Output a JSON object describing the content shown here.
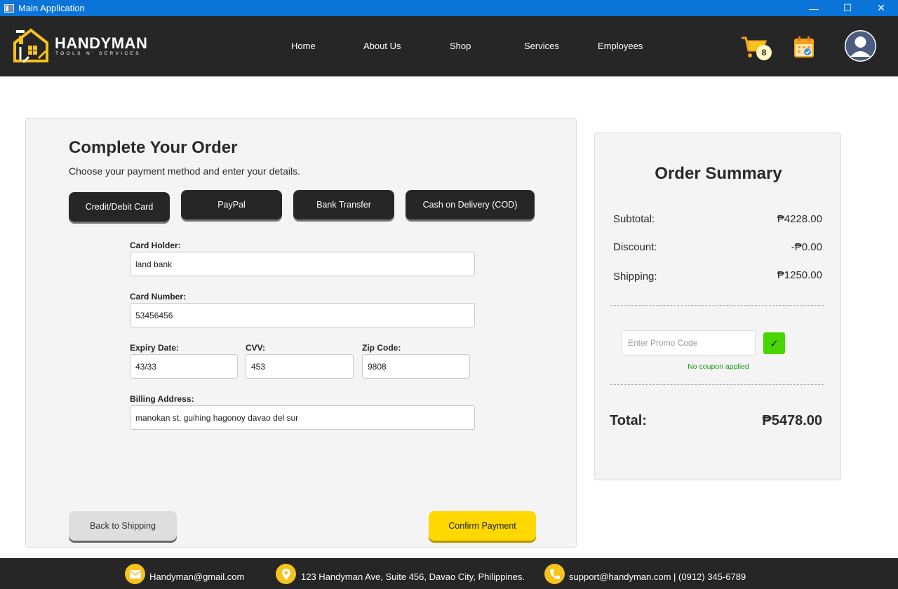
{
  "window": {
    "title": "Main Application",
    "controls": {
      "minimize": "—",
      "maximize": "☐",
      "close": "✕"
    }
  },
  "header": {
    "brand": "HANDYMAN",
    "tagline": "TOOLS N' SERVICES",
    "nav": [
      "Home",
      "About Us",
      "Shop",
      "Services",
      "Employees"
    ],
    "cart_count": "8",
    "icons": {
      "cart": "cart-icon",
      "calendar": "calendar-icon",
      "profile": "avatar-icon"
    }
  },
  "order": {
    "title": "Complete Your Order",
    "subtitle": "Choose your payment method and enter your details.",
    "payment_methods": [
      "Credit/Debit Card",
      "PayPal",
      "Bank Transfer",
      "Cash on Delivery (COD)"
    ],
    "fields": {
      "card_holder": {
        "label": "Card Holder:",
        "value": "land bank"
      },
      "card_number": {
        "label": "Card Number:",
        "value": "53456456"
      },
      "expiry": {
        "label": "Expiry Date:",
        "value": "43/33"
      },
      "cvv": {
        "label": "CVV:",
        "value": "453"
      },
      "zip": {
        "label": "Zip Code:",
        "value": "9808"
      },
      "billing": {
        "label": "Billing Address:",
        "value": "manokan st. guihing hagonoy davao del sur"
      }
    },
    "back_label": "Back to Shipping",
    "confirm_label": "Confirm Payment"
  },
  "summary": {
    "title": "Order Summary",
    "subtotal_label": "Subtotal:",
    "subtotal": "₱4228.00",
    "discount_label": "Discount:",
    "discount": "-₱0.00",
    "shipping_label": "Shipping:",
    "shipping": "₱1250.00",
    "promo_placeholder": "Enter Promo Code",
    "promo_apply": "✓",
    "coupon_status": "No coupon applied",
    "total_label": "Total:",
    "total": "₱5478.00"
  },
  "footer": {
    "email": "Handyman@gmail.com",
    "address": "123 Handyman Ave, Suite 456, Davao City, Philippines.",
    "support": "support@handyman.com | (0912) 345-6789"
  },
  "colors": {
    "header_bg": "#262626",
    "accent_yellow": "#ffd800",
    "titlebar_blue": "#0a74d8",
    "promo_green": "#47d600"
  }
}
